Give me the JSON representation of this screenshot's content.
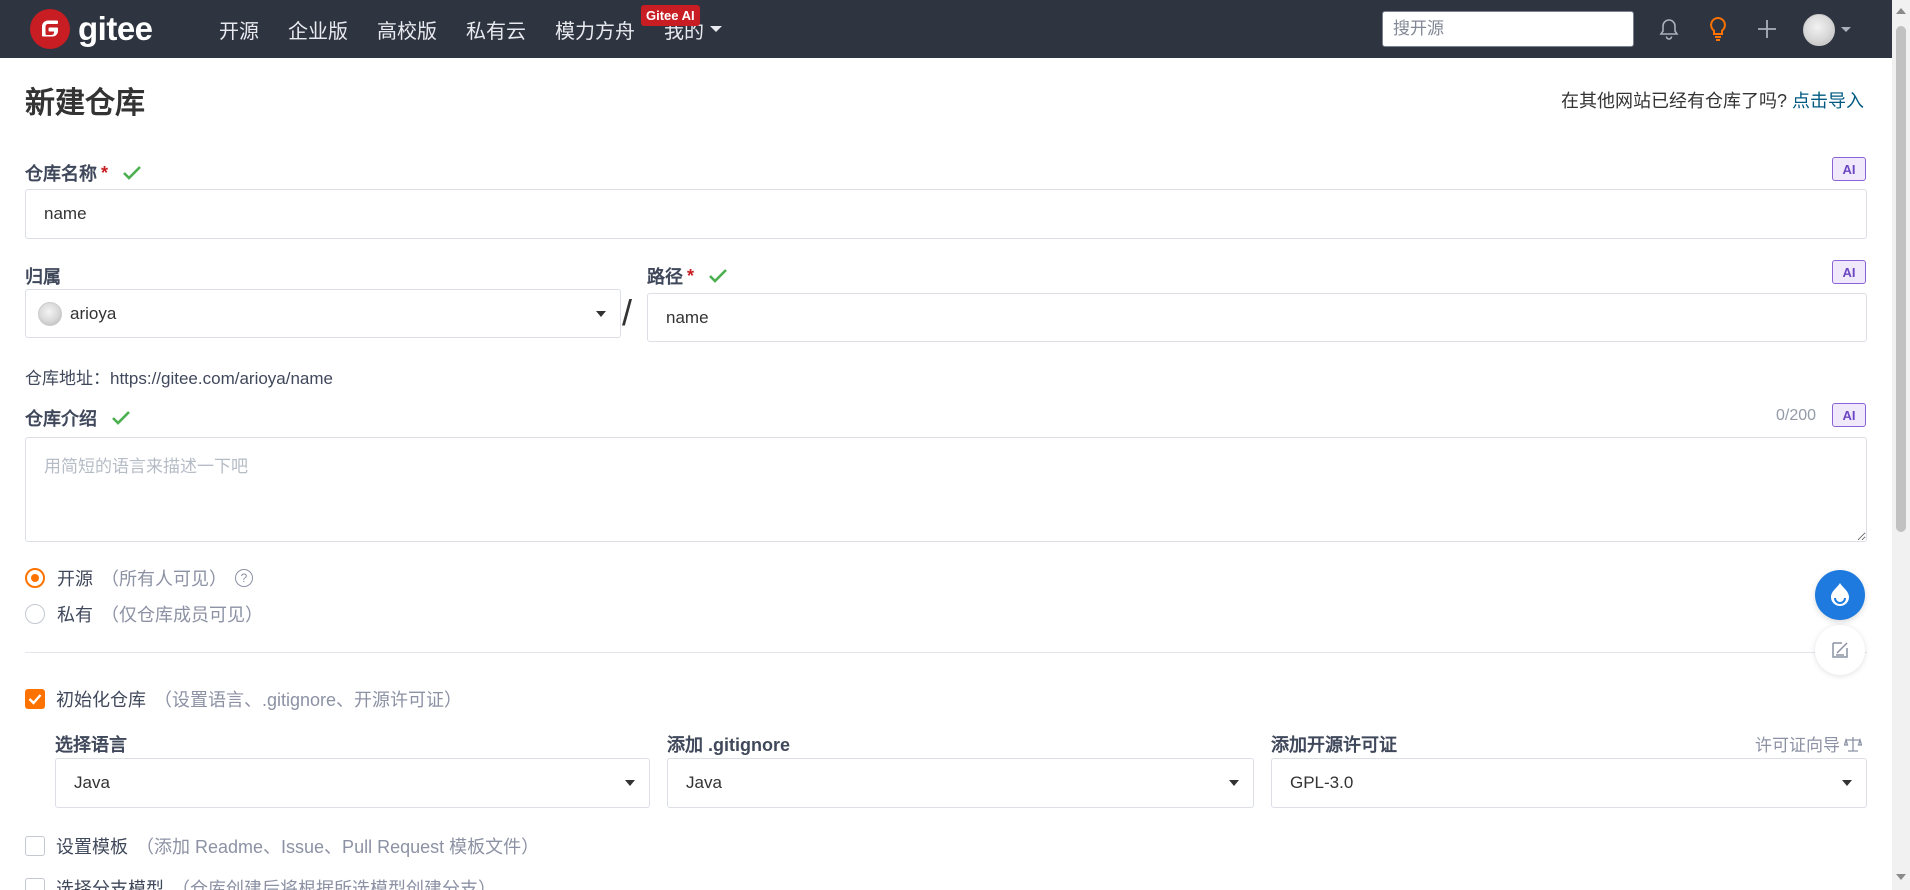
{
  "topbar": {
    "brand": "gitee",
    "nav": [
      "开源",
      "企业版",
      "高校版",
      "私有云",
      "模力方舟",
      "我的"
    ],
    "ai_badge": "Gitee AI",
    "search_placeholder": "搜开源",
    "icons": [
      "bell-icon",
      "lightbulb-icon",
      "plus-icon"
    ]
  },
  "page": {
    "title": "新建仓库",
    "import_hint": "在其他网站已经有仓库了吗?",
    "import_link": "点击导入"
  },
  "form": {
    "repo_name": {
      "label": "仓库名称",
      "required": "*",
      "value": "name",
      "ai": "AI"
    },
    "owner": {
      "label": "归属",
      "value": "arioya"
    },
    "separator": "/",
    "path": {
      "label": "路径",
      "required": "*",
      "value": "name",
      "ai": "AI"
    },
    "repo_url": "仓库地址：https://gitee.com/arioya/name",
    "description": {
      "label": "仓库介绍",
      "counter": "0/200",
      "ai": "AI",
      "placeholder": "用简短的语言来描述一下吧"
    },
    "visibility": [
      {
        "label": "开源",
        "note": "（所有人可见）",
        "selected": true
      },
      {
        "label": "私有",
        "note": "（仅仓库成员可见）",
        "selected": false
      }
    ],
    "init": {
      "label": "初始化仓库",
      "note": "（设置语言、.gitignore、开源许可证）",
      "checked": true
    },
    "language": {
      "label": "选择语言",
      "value": "Java"
    },
    "gitignore": {
      "label": "添加 .gitignore",
      "value": "Java"
    },
    "license": {
      "label": "添加开源许可证",
      "value": "GPL-3.0",
      "guide": "许可证向导"
    },
    "template": {
      "label": "设置模板",
      "note": "（添加 Readme、Issue、Pull Request 模板文件）",
      "checked": false
    },
    "branch_model": {
      "label": "选择分支模型",
      "note": "（仓库创建后将根据所选模型创建分支）",
      "checked": false
    }
  },
  "colors": {
    "topbar_bg": "#2e3440",
    "brand_red": "#c71d23",
    "accent_orange": "#fe7300",
    "link_blue": "#005980",
    "ai_purple": "#6d47c2",
    "success_green": "#4caf50"
  }
}
